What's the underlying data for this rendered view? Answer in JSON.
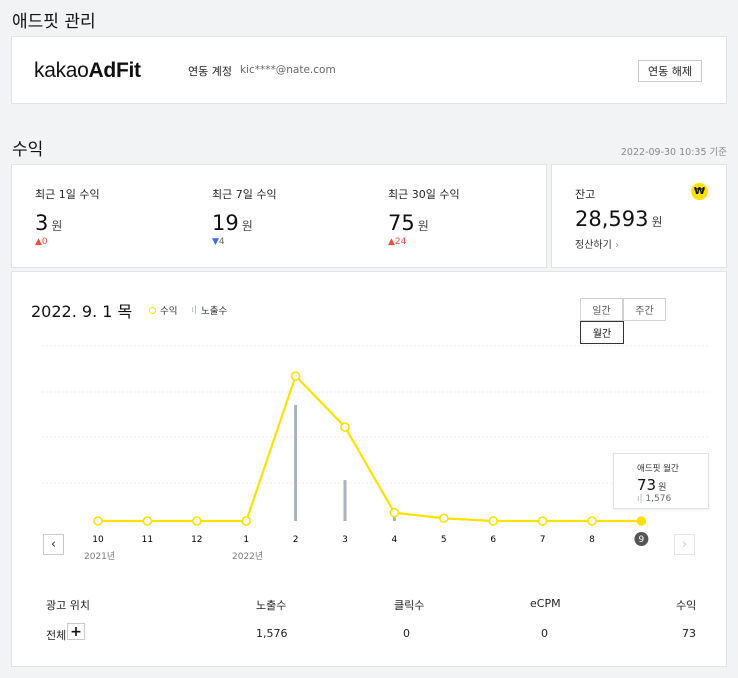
{
  "page_title": "애드핏 관리",
  "account": {
    "logo_light": "kakao",
    "logo_bold": "AdFit",
    "linked_label": "연동 계정",
    "email": "kic****@nate.com",
    "unlink_button": "연동 해제"
  },
  "revenue": {
    "section_title": "수익",
    "timestamp": "2022-09-30 10:35 기준",
    "cards": [
      {
        "label": "최근 1일 수익",
        "value": "3",
        "unit": "원",
        "delta": "0",
        "direction": "up"
      },
      {
        "label": "최근 7일 수익",
        "value": "19",
        "unit": "원",
        "delta": "4",
        "direction": "down"
      },
      {
        "label": "최근 30일 수익",
        "value": "75",
        "unit": "원",
        "delta": "24",
        "direction": "up"
      }
    ],
    "balance": {
      "label": "잔고",
      "value": "28,593",
      "unit": "원",
      "settle_link": "정산하기",
      "won_badge": "₩"
    }
  },
  "chart_panel": {
    "date": "2022. 9. 1 목",
    "legend_revenue": "수익",
    "legend_impressions": "노출수",
    "tabs": [
      "일간",
      "주간",
      "월간"
    ],
    "active_tab": "월간",
    "tooltip": {
      "title": "애드핏 월간",
      "value": "73",
      "unit": "원",
      "impressions": "1,576"
    },
    "year_labels": [
      "2021년",
      "2022년"
    ]
  },
  "chart_data": {
    "type": "line",
    "categories": [
      "10",
      "11",
      "12",
      "1",
      "2",
      "3",
      "4",
      "5",
      "6",
      "7",
      "8",
      "9"
    ],
    "series": [
      {
        "name": "수익",
        "type": "line",
        "color": "#ffe100",
        "values": [
          0,
          0,
          0,
          0,
          1050,
          680,
          60,
          20,
          0,
          0,
          0,
          0
        ]
      },
      {
        "name": "노출수",
        "type": "bar",
        "color": "#a9b2bd",
        "values": [
          0,
          0,
          0,
          0,
          17000,
          6000,
          1900,
          500,
          0,
          0,
          0,
          1576
        ]
      }
    ],
    "highlight_category": "9",
    "grid": true
  },
  "table": {
    "headers": [
      "광고 위치",
      "노출수",
      "클릭수",
      "eCPM",
      "수익"
    ],
    "rows": [
      {
        "position": "전체",
        "expand": "+",
        "impressions": "1,576",
        "clicks": "0",
        "ecpm": "0",
        "revenue": "73"
      }
    ]
  },
  "colors": {
    "accent_yellow": "#ffe100",
    "bar_gray": "#a9b2bd",
    "up_red": "#f04b3e",
    "down_blue": "#3d6ff0"
  }
}
